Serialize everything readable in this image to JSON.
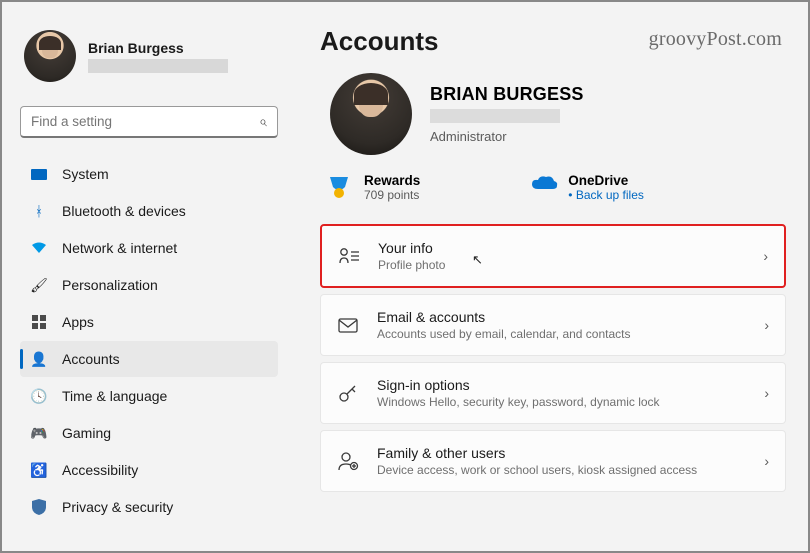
{
  "watermark": "groovyPost.com",
  "user": {
    "name": "Brian Burgess",
    "big_name": "BRIAN BURGESS",
    "role": "Administrator"
  },
  "search": {
    "placeholder": "Find a setting"
  },
  "nav": {
    "items": [
      {
        "label": "System"
      },
      {
        "label": "Bluetooth & devices"
      },
      {
        "label": "Network & internet"
      },
      {
        "label": "Personalization"
      },
      {
        "label": "Apps"
      },
      {
        "label": "Accounts"
      },
      {
        "label": "Time & language"
      },
      {
        "label": "Gaming"
      },
      {
        "label": "Accessibility"
      },
      {
        "label": "Privacy & security"
      }
    ]
  },
  "page": {
    "title": "Accounts"
  },
  "cards": {
    "rewards": {
      "title": "Rewards",
      "sub": "709 points"
    },
    "onedrive": {
      "title": "OneDrive",
      "sub": "Back up files"
    }
  },
  "rows": [
    {
      "title": "Your info",
      "sub": "Profile photo"
    },
    {
      "title": "Email & accounts",
      "sub": "Accounts used by email, calendar, and contacts"
    },
    {
      "title": "Sign-in options",
      "sub": "Windows Hello, security key, password, dynamic lock"
    },
    {
      "title": "Family & other users",
      "sub": "Device access, work or school users, kiosk assigned access"
    }
  ]
}
